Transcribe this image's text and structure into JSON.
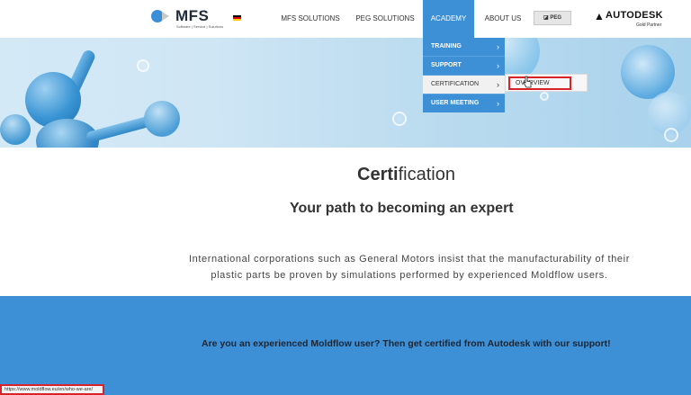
{
  "header": {
    "logo_text": "MFS",
    "logo_tagline": "Software | Service | Solutions",
    "language_flag": "german-flag",
    "nav": [
      {
        "label": "MFS SOLUTIONS"
      },
      {
        "label": "PEG SOLUTIONS"
      },
      {
        "label": "ACADEMY",
        "active": true
      },
      {
        "label": "ABOUT US"
      }
    ],
    "peg_button_label": "PEG",
    "partner_logo_text": "AUTODESK",
    "partner_subtitle": "Gold Partner"
  },
  "dropdown": {
    "items": [
      {
        "label": "TRAINING",
        "chevron": "›"
      },
      {
        "label": "SUPPORT",
        "chevron": "›"
      },
      {
        "label": "CERTIFICATION",
        "chevron": "›",
        "highlighted": true
      },
      {
        "label": "USER MEETING",
        "chevron": "›"
      }
    ],
    "submenu_item": "OVERVIEW"
  },
  "main": {
    "title_bold": "Certi",
    "title_rest": "fication",
    "subtitle": "Your path to becoming an expert",
    "paragraph_line1": "International corporations such as General Motors insist that the manufacturability of their",
    "paragraph_line2": "plastic parts be proven by simulations performed by experienced Moldflow users.",
    "band_text": "Are you an experienced Moldflow user? Then get certified from Autodesk with our support!"
  },
  "statusbar": {
    "url": "https://www.moldflow.eu/en/who-we-are/"
  },
  "colors": {
    "accent": "#3d8fd6",
    "highlight_border": "#d9232b"
  }
}
